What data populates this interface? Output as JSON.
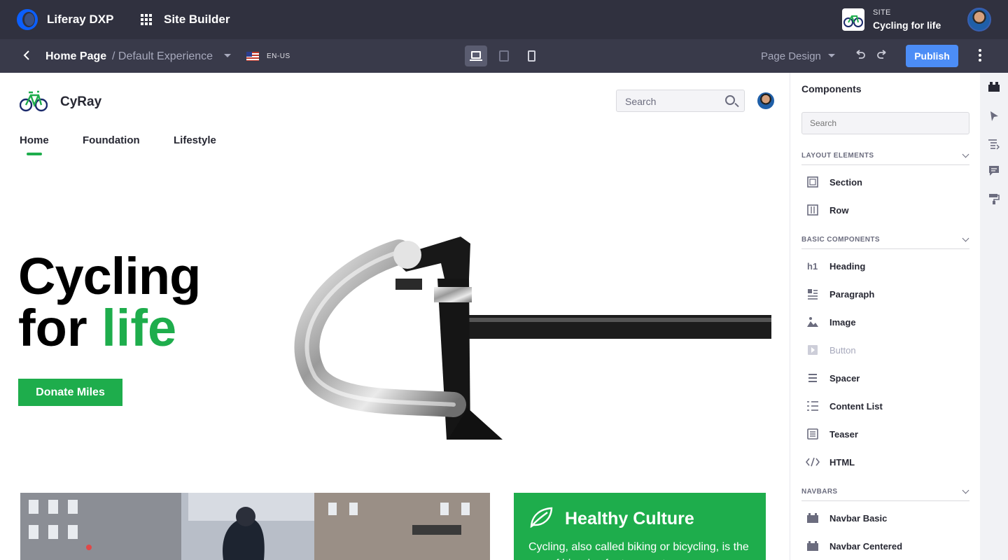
{
  "topbar": {
    "brand": "Liferay DXP",
    "app": "Site Builder",
    "site_label": "SITE",
    "site_name": "Cycling for life"
  },
  "controlbar": {
    "page_title": "Home Page",
    "experience": "/ Default Experience",
    "language": "EN-US",
    "page_design": "Page Design",
    "publish": "Publish"
  },
  "canvas": {
    "brand": "CyRay",
    "search_placeholder": "Search",
    "nav": [
      "Home",
      "Foundation",
      "Lifestyle"
    ],
    "hero_line1": "Cycling",
    "hero_line2_a": "for ",
    "hero_line2_b": "life",
    "donate": "Donate Miles",
    "card_title": "Healthy Culture",
    "card_body": "Cycling, also called biking or bicycling, is the use of bicycles for transport,"
  },
  "sidebar": {
    "title": "Components",
    "search_placeholder": "Search",
    "sections": [
      {
        "label": "LAYOUT ELEMENTS",
        "items": [
          "Section",
          "Row"
        ]
      },
      {
        "label": "BASIC COMPONENTS",
        "items": [
          "Heading",
          "Paragraph",
          "Image",
          "Button",
          "Spacer",
          "Content List",
          "Teaser",
          "HTML"
        ]
      },
      {
        "label": "NAVBARS",
        "items": [
          "Navbar Basic",
          "Navbar Centered"
        ]
      }
    ]
  },
  "colors": {
    "topbar": "#30313f",
    "controlbar": "#393a4a",
    "publish": "#4c8df6",
    "brand_green": "#1ead4c"
  }
}
